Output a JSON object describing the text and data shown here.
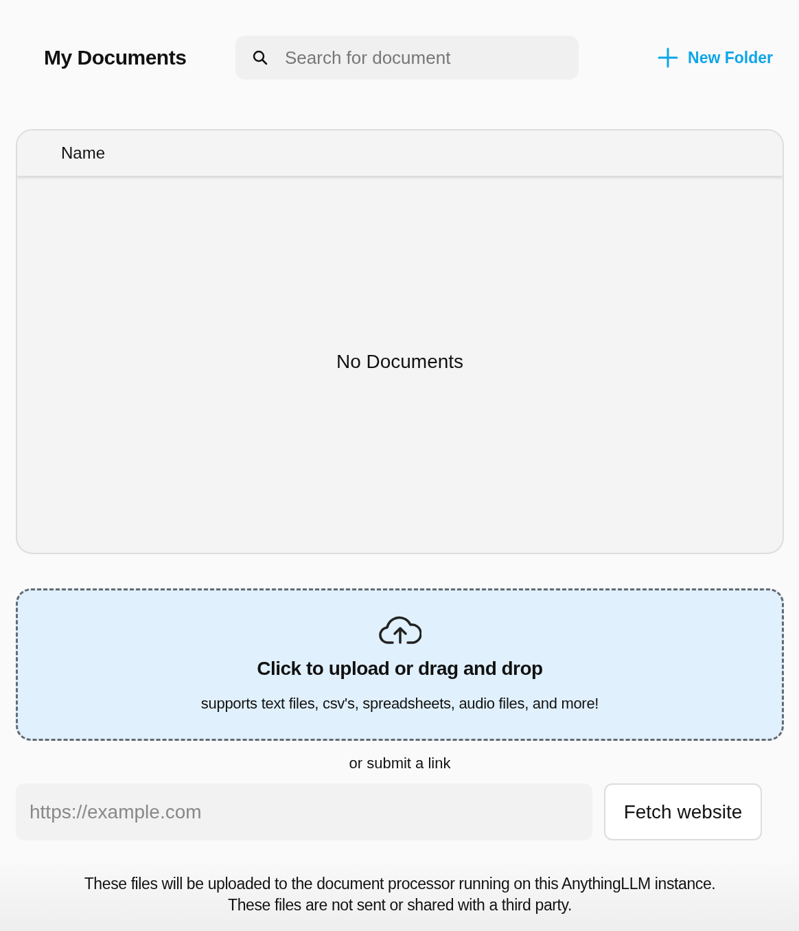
{
  "header": {
    "title": "My Documents",
    "search": {
      "placeholder": "Search for document"
    },
    "new_folder_button": {
      "label": "New Folder"
    }
  },
  "table": {
    "columns": [
      "Name"
    ],
    "empty_message": "No Documents"
  },
  "upload": {
    "title": "Click to upload or drag and drop",
    "subtitle": "supports text files, csv's, spreadsheets, audio files, and more!"
  },
  "link": {
    "caption": "or submit a link",
    "placeholder": "https://example.com",
    "button": "Fetch website"
  },
  "footer": [
    "These files will be uploaded to the document processor running on this AnythingLLM instance.",
    "These files are not sent or shared with a third party."
  ]
}
